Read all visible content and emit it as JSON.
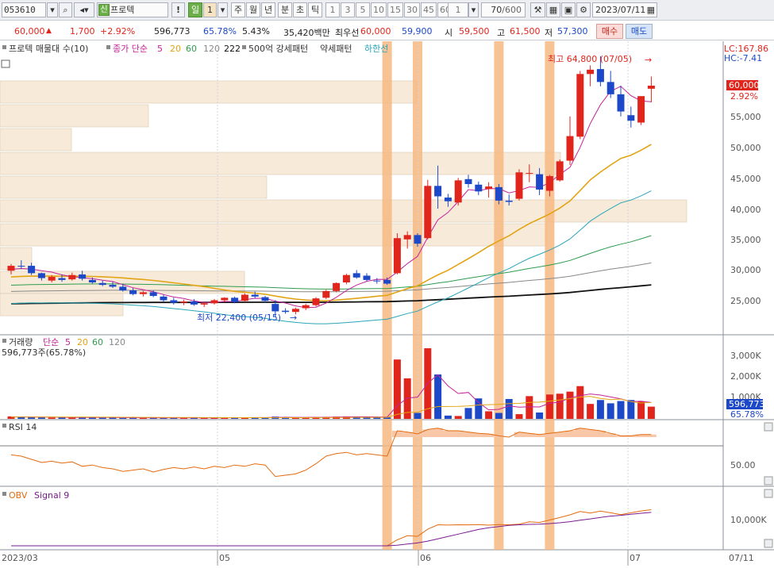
{
  "toolbar": {
    "code": "053610",
    "new_badge": "신",
    "name": "프로텍",
    "mark": "!",
    "interval_day": "일",
    "interval_n": "1",
    "period_labels": [
      "주",
      "월",
      "년",
      "분",
      "초",
      "틱"
    ],
    "minute_options": [
      "1",
      "3",
      "5",
      "10",
      "15",
      "30",
      "45",
      "60"
    ],
    "step": "1",
    "count": "70",
    "count_total": "/600",
    "date": "2023/07/11"
  },
  "quote": {
    "price": "60,000",
    "change": "1,700",
    "change_pct": "+2.92%",
    "volume": "596,773",
    "volume_ratio": "65.78%",
    "turnover": "5.43%",
    "amount": "35,420백만",
    "best_label": "최우선",
    "ask": "60,000",
    "bid": "59,900",
    "open_label": "시",
    "open": "59,500",
    "high_label": "고",
    "high": "61,500",
    "low_label": "저",
    "low": "57,300",
    "buy_label": "매수",
    "sell_label": "매도"
  },
  "price_legend": {
    "title": "프로텍 매물대 수(10)",
    "ma_label": "종가 단순",
    "ma_periods": [
      "5",
      "20",
      "60",
      "120",
      "222"
    ],
    "pattern1": "500억 강세패턴",
    "pattern2": "약세패턴",
    "pattern3": "하한선",
    "lc": "LC:167.86",
    "hc": "HC:-7.41",
    "high_note": "최고 64,800 (07/05)",
    "low_note": "최저 22,400 (05/15)",
    "price_tag": "60,000",
    "pct_tag": "2.92%",
    "y_ticks": [
      "55,000",
      "50,000",
      "45,000",
      "40,000",
      "35,000",
      "30,000",
      "25,000"
    ]
  },
  "volume_legend": {
    "label": "거래량",
    "ma_label": "단순",
    "ma_periods": [
      "5",
      "20",
      "60",
      "120"
    ],
    "value_line": "596,773주(65.78%)",
    "y_ticks": [
      "3,000K",
      "2,000K",
      "1,000K"
    ],
    "tag": "596,773",
    "tag_pct": "65.78%"
  },
  "rsi_legend": {
    "label": "RSI 14",
    "y_tick": "50.00"
  },
  "obv_legend": {
    "label": "OBV",
    "signal": "Signal 9",
    "y_tick": "10,000K"
  },
  "x_labels": [
    "2023/03",
    "05",
    "06",
    "07",
    "07/11"
  ],
  "colors": {
    "up": "#e0261c",
    "down": "#1d49c9",
    "ma5": "#c4239a",
    "ma20": "#e3a414",
    "ma60": "#2e9c4e",
    "ma120": "#888888",
    "ma222": "#111111",
    "lower_band": "#2aa5b8",
    "signal_bar": "#f6b981",
    "volume_profile": "#f7ead9"
  },
  "chart_data": {
    "type": "candlestick",
    "date_range": [
      "2023/03",
      "2023/07/11"
    ],
    "y_range": [
      22400,
      64800
    ],
    "highlight_days": [
      37,
      40,
      48,
      53
    ],
    "candles": [
      [
        29900,
        31000,
        29300,
        30700
      ],
      [
        30700,
        31600,
        30200,
        30600
      ],
      [
        30700,
        31200,
        29200,
        29500
      ],
      [
        29500,
        29600,
        28300,
        28700
      ],
      [
        28300,
        29200,
        28000,
        28900
      ],
      [
        28700,
        29300,
        28100,
        28400
      ],
      [
        28500,
        29600,
        28300,
        29200
      ],
      [
        29300,
        29900,
        28300,
        28600
      ],
      [
        28400,
        28800,
        27800,
        28000
      ],
      [
        27900,
        28300,
        27400,
        27600
      ],
      [
        27600,
        28100,
        27100,
        27300
      ],
      [
        27300,
        27700,
        26500,
        26700
      ],
      [
        26700,
        27100,
        25900,
        26100
      ],
      [
        26100,
        26600,
        25700,
        26400
      ],
      [
        26400,
        26700,
        25600,
        25800
      ],
      [
        25700,
        26000,
        24800,
        25100
      ],
      [
        25100,
        25500,
        24400,
        24700
      ],
      [
        24700,
        25200,
        24300,
        24900
      ],
      [
        24900,
        25300,
        24200,
        24400
      ],
      [
        24400,
        24800,
        24000,
        24600
      ],
      [
        24600,
        25300,
        24400,
        25100
      ],
      [
        25100,
        25600,
        24800,
        25500
      ],
      [
        25500,
        25700,
        24600,
        24800
      ],
      [
        25000,
        26200,
        24800,
        26000
      ],
      [
        26000,
        26500,
        25400,
        25700
      ],
      [
        25600,
        25800,
        24700,
        25000
      ],
      [
        24500,
        25100,
        22400,
        23300
      ],
      [
        23400,
        23800,
        22900,
        23200
      ],
      [
        23200,
        23900,
        22800,
        23700
      ],
      [
        23800,
        24500,
        23500,
        24300
      ],
      [
        24300,
        25600,
        24100,
        25400
      ],
      [
        25500,
        26800,
        25300,
        26600
      ],
      [
        26600,
        28000,
        26400,
        27900
      ],
      [
        28000,
        29400,
        27700,
        29200
      ],
      [
        29500,
        30000,
        28600,
        28800
      ],
      [
        29100,
        29500,
        28200,
        28400
      ],
      [
        28300,
        28700,
        27800,
        28200
      ],
      [
        28400,
        28800,
        27600,
        27800
      ],
      [
        29500,
        36000,
        29300,
        35200
      ],
      [
        35000,
        36300,
        33500,
        35700
      ],
      [
        35700,
        36000,
        33800,
        34300
      ],
      [
        35200,
        44700,
        35000,
        43700
      ],
      [
        43700,
        47000,
        40000,
        42000
      ],
      [
        41800,
        42400,
        40300,
        41200
      ],
      [
        41000,
        45000,
        40500,
        44600
      ],
      [
        44800,
        45500,
        43400,
        44000
      ],
      [
        43900,
        44400,
        42200,
        42800
      ],
      [
        43200,
        44300,
        41800,
        43600
      ],
      [
        43500,
        44000,
        40700,
        41300
      ],
      [
        41300,
        42300,
        40500,
        41100
      ],
      [
        41600,
        46400,
        41300,
        45900
      ],
      [
        45800,
        47200,
        44300,
        45800
      ],
      [
        45600,
        46600,
        42200,
        43100
      ],
      [
        42900,
        45500,
        42000,
        45300
      ],
      [
        44600,
        48000,
        44400,
        47700
      ],
      [
        47800,
        55000,
        47100,
        51800
      ],
      [
        51700,
        62400,
        51300,
        61900
      ],
      [
        61900,
        63300,
        59900,
        62600
      ],
      [
        62700,
        64800,
        59900,
        60600
      ],
      [
        60600,
        62400,
        58000,
        58600
      ],
      [
        58600,
        60000,
        55000,
        55800
      ],
      [
        55200,
        56600,
        53200,
        54300
      ],
      [
        54000,
        58000,
        53600,
        58300
      ],
      [
        59500,
        61500,
        57300,
        60000
      ]
    ],
    "volume": [
      120,
      90,
      80,
      70,
      60,
      60,
      80,
      70,
      60,
      60,
      60,
      50,
      50,
      50,
      50,
      60,
      50,
      50,
      50,
      50,
      60,
      60,
      50,
      70,
      70,
      60,
      110,
      70,
      60,
      70,
      80,
      100,
      110,
      120,
      90,
      80,
      70,
      70,
      2900,
      1980,
      290,
      3450,
      2170,
      160,
      140,
      530,
      1000,
      370,
      290,
      970,
      230,
      1110,
      310,
      1190,
      1230,
      1330,
      1600,
      730,
      920,
      760,
      870,
      920,
      850,
      597
    ],
    "volume_unit": "K",
    "rsi": [
      42,
      40,
      35,
      30,
      32,
      29,
      31,
      24,
      26,
      22,
      20,
      16,
      18,
      20,
      15,
      19,
      22,
      20,
      23,
      20,
      24,
      22,
      26,
      24,
      28,
      26,
      8,
      10,
      12,
      18,
      28,
      40,
      44,
      46,
      42,
      44,
      42,
      40,
      80,
      78,
      75,
      82,
      84,
      80,
      80,
      78,
      76,
      75,
      72,
      70,
      78,
      76,
      74,
      76,
      78,
      80,
      84,
      82,
      80,
      76,
      72,
      72,
      74,
      74
    ],
    "obv": [
      0,
      0,
      0,
      0,
      0,
      0,
      0,
      0,
      0,
      0,
      0,
      0,
      0,
      0,
      0,
      0,
      0,
      0,
      0,
      0,
      0,
      0,
      0,
      0,
      0,
      0,
      0,
      0,
      0,
      0,
      0,
      0,
      0,
      0,
      0,
      0,
      0,
      0,
      2900,
      4880,
      4590,
      8040,
      10200,
      10050,
      10200,
      10150,
      10300,
      10000,
      10300,
      10200,
      10500,
      11600,
      11300,
      12500,
      13700,
      15000,
      16600,
      15900,
      16800,
      16000,
      15100,
      16000,
      16900,
      17500
    ],
    "obv_unit": "K"
  }
}
